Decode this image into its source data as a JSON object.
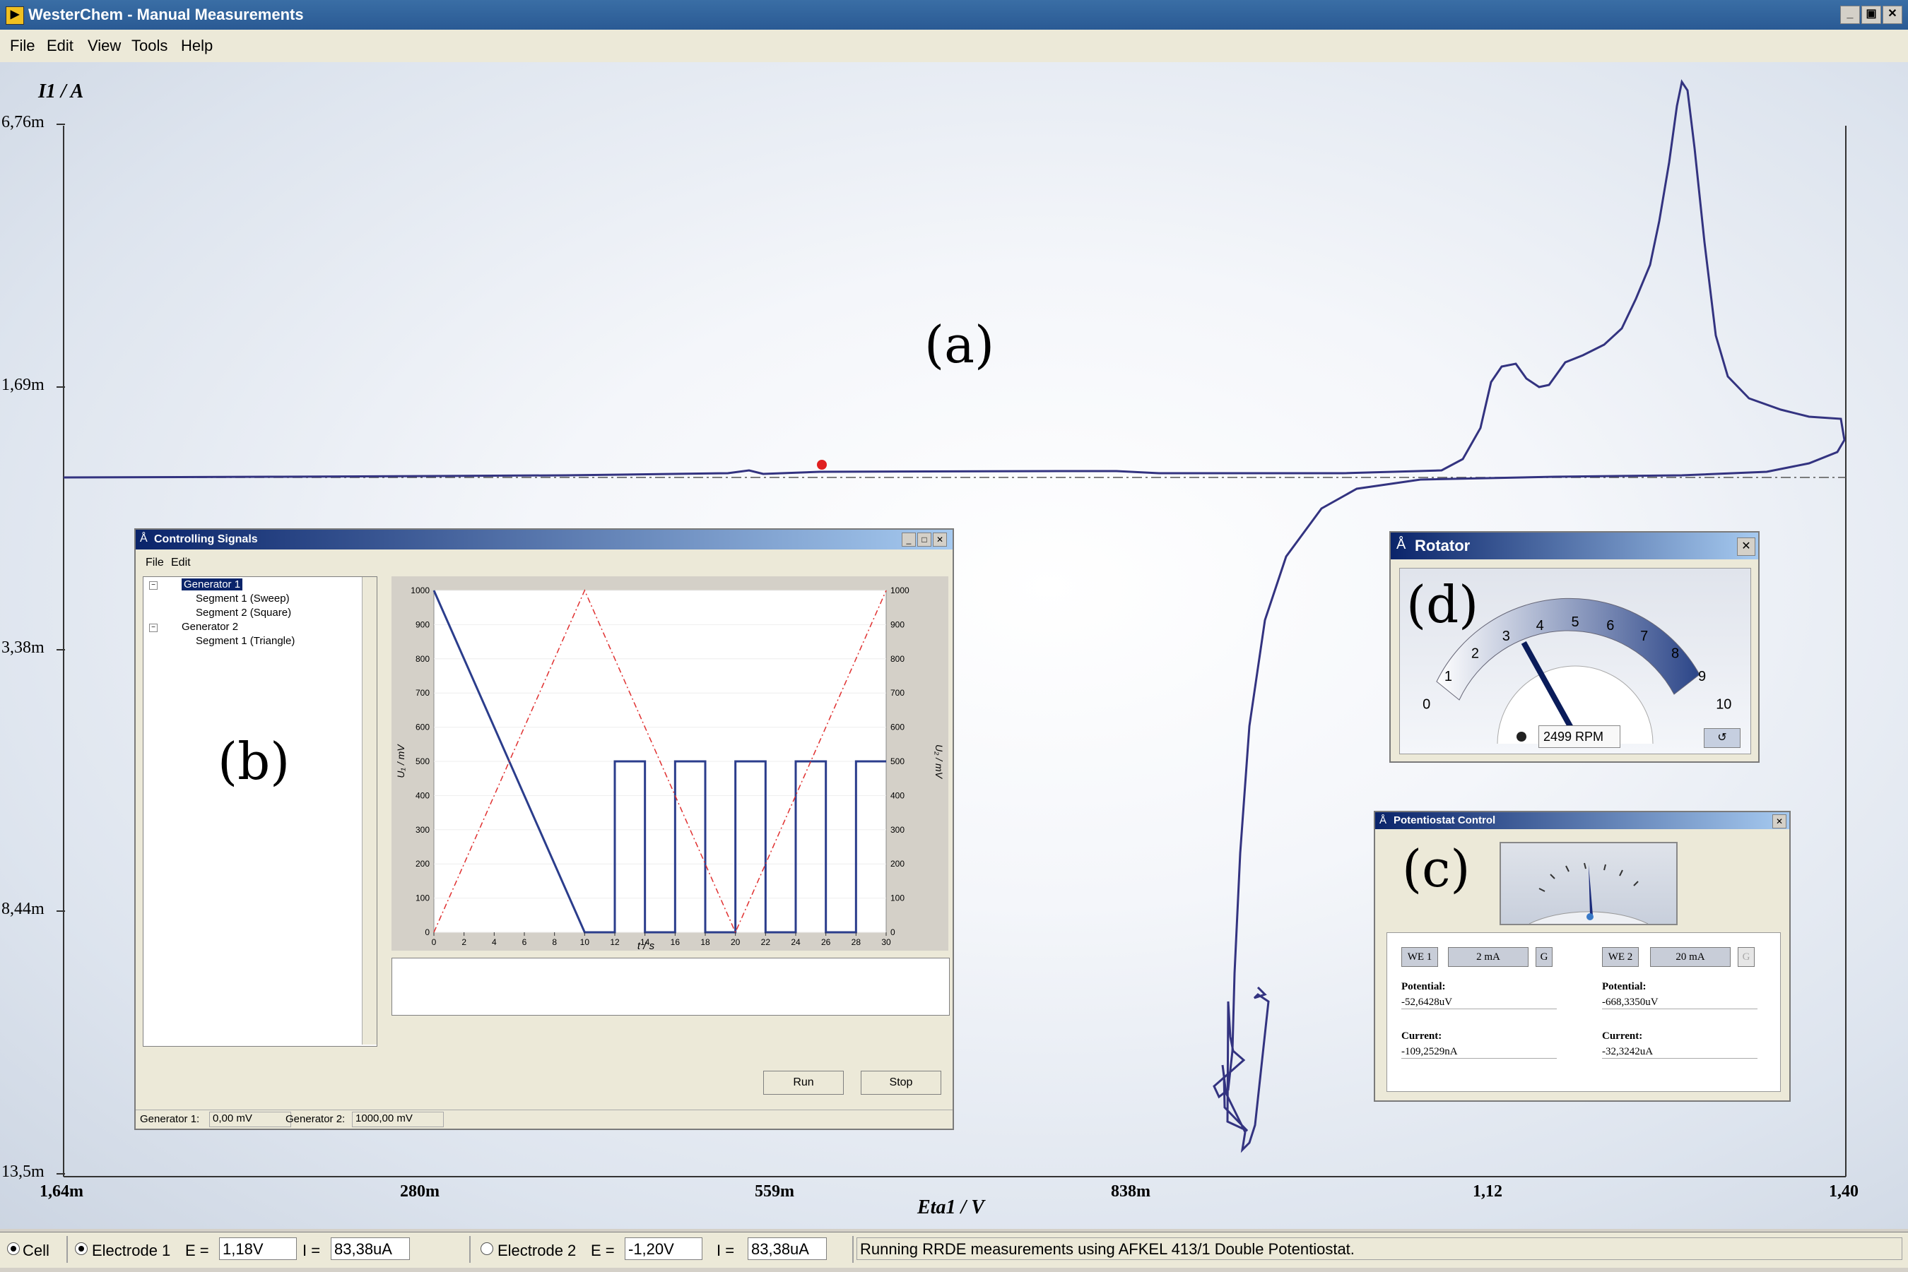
{
  "app": {
    "title": "WesterChem - Manual Measurements",
    "window_buttons": [
      "_",
      "▣",
      "✕"
    ]
  },
  "menu": [
    "File",
    "Edit",
    "View",
    "Tools",
    "Help"
  ],
  "plot": {
    "ylabel": "I1 / A",
    "xlabel": "Eta1 / V",
    "yticks": [
      "6,76m",
      "1,69m",
      "3,38m",
      "8,44m",
      "13,5m"
    ],
    "xticks": [
      "1,64m",
      "280m",
      "559m",
      "838m",
      "1,12",
      "1,40"
    ],
    "curve_color": "#333380",
    "marker_color": "#e02020"
  },
  "annotations": {
    "a": "(a)",
    "b": "(b)",
    "c": "(c)",
    "d": "(d)"
  },
  "controlling_signals": {
    "title": "Controlling Signals",
    "menu": [
      "File",
      "Edit"
    ],
    "tree": [
      {
        "label": "Generator 1",
        "selected": true
      },
      {
        "label": "Segment 1 (Sweep)"
      },
      {
        "label": "Segment 2 (Square)"
      },
      {
        "label": "Generator 2"
      },
      {
        "label": "Segment 1 (Triangle)"
      }
    ],
    "run_label": "Run",
    "stop_label": "Stop",
    "status": {
      "g1_label": "Generator 1:",
      "g1_value": "0,00 mV",
      "g2_label": "Generator 2:",
      "g2_value": "1000,00 mV"
    },
    "chart_data": {
      "type": "line",
      "xlabel": "t / s",
      "ylabel": "U₁ / mV",
      "ylabel_right": "U₂ / mV",
      "xlim": [
        0,
        30
      ],
      "ylim": [
        0,
        1000
      ],
      "xticks": [
        0,
        2,
        4,
        6,
        8,
        10,
        12,
        14,
        16,
        18,
        20,
        22,
        24,
        26,
        28,
        30
      ],
      "yticks": [
        0,
        100,
        200,
        300,
        400,
        500,
        600,
        700,
        800,
        900,
        1000
      ],
      "series": [
        {
          "color": "#2b3d8c",
          "style": "solid",
          "x": [
            0,
            10,
            12,
            12,
            14,
            14,
            16,
            16,
            18,
            18,
            20,
            20,
            22,
            22,
            24,
            24,
            26,
            26,
            28,
            28,
            30
          ],
          "y": [
            1000,
            0,
            0,
            500,
            500,
            0,
            0,
            500,
            500,
            0,
            0,
            500,
            500,
            0,
            0,
            500,
            500,
            0,
            0,
            500,
            500
          ]
        },
        {
          "color": "#e03030",
          "style": "dashdot",
          "x": [
            0,
            10,
            20,
            30
          ],
          "y": [
            0,
            1000,
            0,
            1000
          ]
        }
      ]
    }
  },
  "rotator": {
    "title": "Rotator",
    "scale": [
      "0",
      "1",
      "2",
      "3",
      "4",
      "5",
      "6",
      "7",
      "8",
      "9",
      "10"
    ],
    "rpm_value": 2499,
    "rpm_text": "2499 RPM"
  },
  "potentiostat": {
    "title": "Potentiostat Control",
    "we1": {
      "label": "WE 1",
      "range": "2 mA",
      "g": "G",
      "potential_label": "Potential:",
      "potential": "-52,6428uV",
      "current_label": "Current:",
      "current": "-109,2529nA"
    },
    "we2": {
      "label": "WE 2",
      "range": "20 mA",
      "g": "G",
      "potential_label": "Potential:",
      "potential": "-668,3350uV",
      "current_label": "Current:",
      "current": "-32,3242uA"
    }
  },
  "statusbar": {
    "cell": "Cell",
    "e1_label": "Electrode 1",
    "e1_E_label": "E =",
    "e1_E": "1,18V",
    "e1_I_label": "I =",
    "e1_I": "83,38uA",
    "e2_label": "Electrode 2",
    "e2_E_label": "E =",
    "e2_E": "-1,20V",
    "e2_I_label": "I =",
    "e2_I": "83,38uA",
    "message": "Running RRDE measurements using AFKEL 413/1 Double Potentiostat."
  }
}
